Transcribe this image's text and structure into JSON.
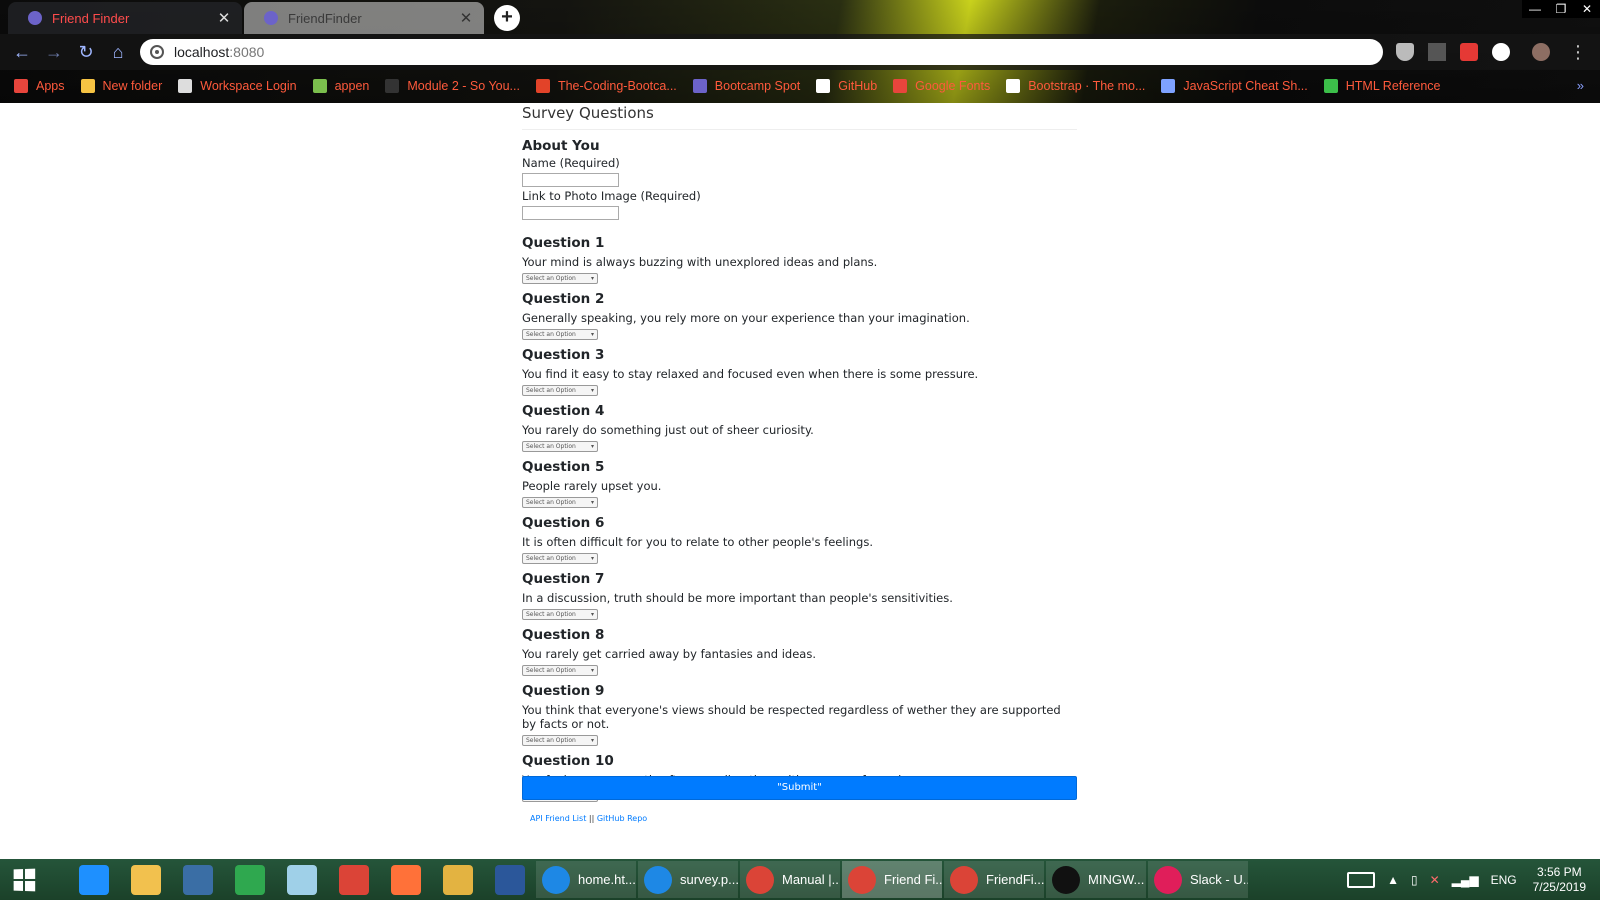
{
  "browser": {
    "tabs": [
      {
        "title": "Friend Finder",
        "active": true
      },
      {
        "title": "FriendFinder",
        "active": false
      }
    ],
    "url_host": "localhost",
    "url_port": ":8080",
    "bookmarks": [
      {
        "label": "Apps",
        "icon": "apps-grid-icon",
        "color": "#e8453c"
      },
      {
        "label": "New folder",
        "icon": "folder-icon",
        "color": "#f6c343"
      },
      {
        "label": "Workspace Login",
        "icon": "mail-icon",
        "color": "#dddddd"
      },
      {
        "label": "appen",
        "icon": "appen-icon",
        "color": "#7bbf4d"
      },
      {
        "label": "Module 2 - So You...",
        "icon": "book-icon",
        "color": "#333333"
      },
      {
        "label": "The-Coding-Bootca...",
        "icon": "gitlab-icon",
        "color": "#e24329"
      },
      {
        "label": "Bootcamp Spot",
        "icon": "bootcamp-icon",
        "color": "#6c63c9"
      },
      {
        "label": "GitHub",
        "icon": "github-icon",
        "color": "#ffffff"
      },
      {
        "label": "Google Fonts",
        "icon": "google-fonts-icon",
        "color": "#e8453c"
      },
      {
        "label": "Bootstrap · The mo...",
        "icon": "bootstrap-icon",
        "color": "#ffffff"
      },
      {
        "label": "JavaScript Cheat Sh...",
        "icon": "js-cheat-icon",
        "color": "#7ea2ff"
      },
      {
        "label": "HTML Reference",
        "icon": "html-ref-icon",
        "color": "#3cbf4a"
      }
    ],
    "bookmarks_more": "»"
  },
  "page": {
    "title": "Survey Questions",
    "about_heading": "About You",
    "name_label": "Name (Required)",
    "photo_label": "Link to Photo Image (Required)",
    "select_placeholder": "Select an Option",
    "questions": [
      {
        "title": "Question 1",
        "text": "Your mind is always buzzing with unexplored ideas and plans."
      },
      {
        "title": "Question 2",
        "text": "Generally speaking, you rely more on your experience than your imagination."
      },
      {
        "title": "Question 3",
        "text": "You find it easy to stay relaxed and focused even when there is some pressure."
      },
      {
        "title": "Question 4",
        "text": "You rarely do something just out of sheer curiosity."
      },
      {
        "title": "Question 5",
        "text": "People rarely upset you."
      },
      {
        "title": "Question 6",
        "text": "It is often difficult for you to relate to other people's feelings."
      },
      {
        "title": "Question 7",
        "text": "In a discussion, truth should be more important than people's sensitivities."
      },
      {
        "title": "Question 8",
        "text": "You rarely get carried away by fantasies and ideas."
      },
      {
        "title": "Question 9",
        "text": "You think that everyone's views should be respected regardless of wether they are supported by facts or not."
      },
      {
        "title": "Question 10",
        "text": "You feel more energetic after spending time with a group of people."
      }
    ],
    "submit_label": "\"Submit\"",
    "footer_link1": "API Friend List",
    "footer_sep": "||",
    "footer_link2": "GitHub Repo",
    "accent_color": "#007bff"
  },
  "taskbar": {
    "pinned": [
      {
        "name": "internet-explorer-icon",
        "color": "#1e90ff"
      },
      {
        "name": "file-explorer-icon",
        "color": "#f2c14e"
      },
      {
        "name": "lenovo-icon",
        "color": "#3a6ea5"
      },
      {
        "name": "store-icon",
        "color": "#2fa84f"
      },
      {
        "name": "notepad-icon",
        "color": "#9fd0e8"
      },
      {
        "name": "chrome-icon",
        "color": "#db4437"
      },
      {
        "name": "firefox-icon",
        "color": "#ff7139"
      },
      {
        "name": "git-icon",
        "color": "#e3b341"
      },
      {
        "name": "word-icon",
        "color": "#2b579a"
      }
    ],
    "apps": [
      {
        "label": "home.ht...",
        "icon": "vscode-icon",
        "color": "#1e88e5",
        "active": false
      },
      {
        "label": "survey.p...",
        "icon": "vscode-icon",
        "color": "#1e88e5",
        "active": false
      },
      {
        "label": "Manual |...",
        "icon": "chrome-icon",
        "color": "#db4437",
        "active": false
      },
      {
        "label": "Friend Fi...",
        "icon": "chrome-icon",
        "color": "#db4437",
        "active": true
      },
      {
        "label": "FriendFi...",
        "icon": "chrome-icon",
        "color": "#db4437",
        "active": false
      },
      {
        "label": "MINGW...",
        "icon": "terminal-icon",
        "color": "#111111",
        "active": false
      },
      {
        "label": "Slack - U...",
        "icon": "slack-icon",
        "color": "#e01e5a",
        "active": false
      }
    ],
    "language": "ENG",
    "time": "3:56 PM",
    "date": "7/25/2019"
  }
}
